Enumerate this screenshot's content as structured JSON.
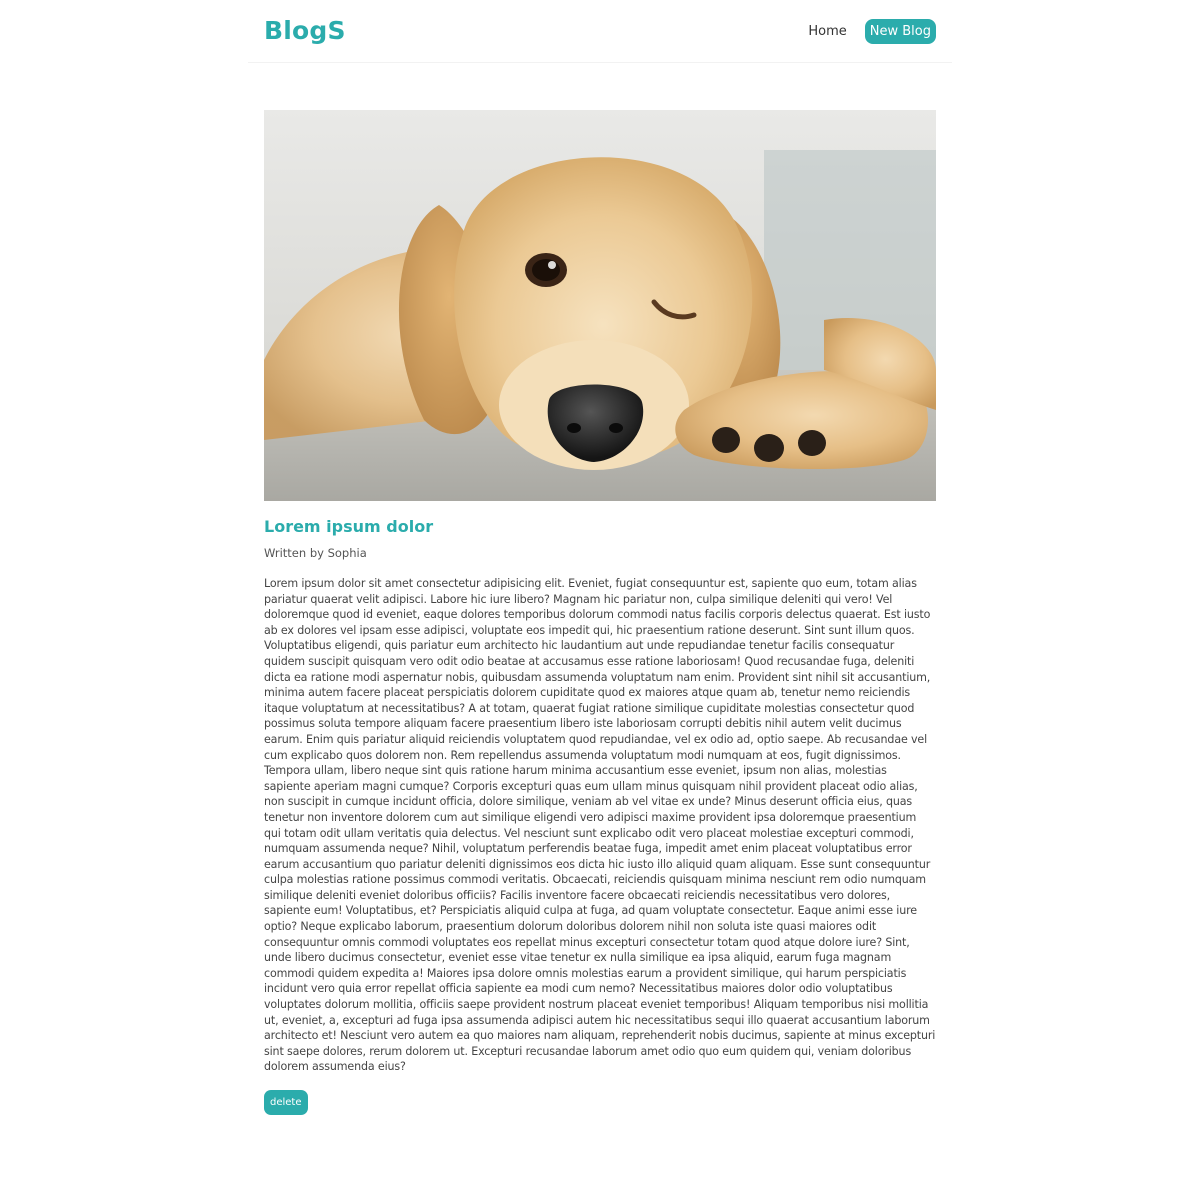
{
  "header": {
    "brand": "BlogS",
    "nav": {
      "home_label": "Home",
      "new_blog_label": "New Blog"
    },
    "accent_color": "#2bacac"
  },
  "post": {
    "image_subject": "golden-retriever-puppy-photo",
    "title": "Lorem ipsum dolor",
    "byline": "Written by Sophia",
    "body": "Lorem ipsum dolor sit amet consectetur adipisicing elit. Eveniet, fugiat consequuntur est, sapiente quo eum, totam alias pariatur quaerat velit adipisci. Labore hic iure libero? Magnam hic pariatur non, culpa similique deleniti qui vero! Vel doloremque quod id eveniet, eaque dolores temporibus dolorum commodi natus facilis corporis delectus quaerat. Est iusto ab ex dolores vel ipsam esse adipisci, voluptate eos impedit qui, hic praesentium ratione deserunt. Sint sunt illum quos. Voluptatibus eligendi, quis pariatur eum architecto hic laudantium aut unde repudiandae tenetur facilis consequatur quidem suscipit quisquam vero odit odio beatae at accusamus esse ratione laboriosam! Quod recusandae fuga, deleniti dicta ea ratione modi aspernatur nobis, quibusdam assumenda voluptatum nam enim. Provident sint nihil sit accusantium, minima autem facere placeat perspiciatis dolorem cupiditate quod ex maiores atque quam ab, tenetur nemo reiciendis itaque voluptatum at necessitatibus? A at totam, quaerat fugiat ratione similique cupiditate molestias consectetur quod possimus soluta tempore aliquam facere praesentium libero iste laboriosam corrupti debitis nihil autem velit ducimus earum. Enim quis pariatur aliquid reiciendis voluptatem quod repudiandae, vel ex odio ad, optio saepe. Ab recusandae vel cum explicabo quos dolorem non. Rem repellendus assumenda voluptatum modi numquam at eos, fugit dignissimos. Tempora ullam, libero neque sint quis ratione harum minima accusantium esse eveniet, ipsum non alias, molestias sapiente aperiam magni cumque? Corporis excepturi quas eum ullam minus quisquam nihil provident placeat odio alias, non suscipit in cumque incidunt officia, dolore similique, veniam ab vel vitae ex unde? Minus deserunt officia eius, quas tenetur non inventore dolorem cum aut similique eligendi vero adipisci maxime provident ipsa doloremque praesentium qui totam odit ullam veritatis quia delectus. Vel nesciunt sunt explicabo odit vero placeat molestiae excepturi commodi, numquam assumenda neque? Nihil, voluptatum perferendis beatae fuga, impedit amet enim placeat voluptatibus error earum accusantium quo pariatur deleniti dignissimos eos dicta hic iusto illo aliquid quam aliquam. Esse sunt consequuntur culpa molestias ratione possimus commodi veritatis. Obcaecati, reiciendis quisquam minima nesciunt rem odio numquam similique deleniti eveniet doloribus officiis? Facilis inventore facere obcaecati reiciendis necessitatibus vero dolores, sapiente eum! Voluptatibus, et? Perspiciatis aliquid culpa at fuga, ad quam voluptate consectetur. Eaque animi esse iure optio? Neque explicabo laborum, praesentium dolorum doloribus dolorem nihil non soluta iste quasi maiores odit consequuntur omnis commodi voluptates eos repellat minus excepturi consectetur totam quod atque dolore iure? Sint, unde libero ducimus consectetur, eveniet esse vitae tenetur ex nulla similique ea ipsa aliquid, earum fuga magnam commodi quidem expedita a! Maiores ipsa dolore omnis molestias earum a provident similique, qui harum perspiciatis incidunt vero quia error repellat officia sapiente ea modi cum nemo? Necessitatibus maiores dolor odio voluptatibus voluptates dolorum mollitia, officiis saepe provident nostrum placeat eveniet temporibus! Aliquam temporibus nisi mollitia ut, eveniet, a, excepturi ad fuga ipsa assumenda adipisci autem hic necessitatibus sequi illo quaerat accusantium laborum architecto et! Nesciunt vero autem ea quo maiores nam aliquam, reprehenderit nobis ducimus, sapiente at minus excepturi sint saepe dolores, rerum dolorem ut. Excepturi recusandae laborum amet odio quo eum quidem qui, veniam doloribus dolorem assumenda eius?",
    "delete_label": "delete"
  }
}
